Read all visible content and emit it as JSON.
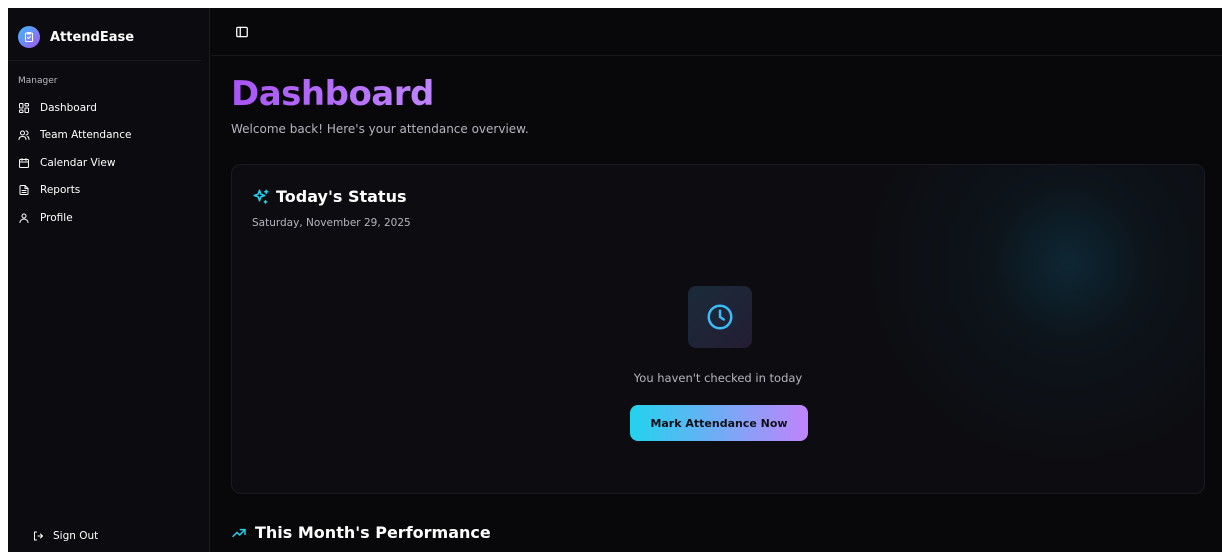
{
  "app": {
    "name": "AttendEase"
  },
  "sidebar": {
    "section_label": "Manager",
    "items": [
      {
        "label": "Dashboard",
        "icon": "dashboard-icon"
      },
      {
        "label": "Team Attendance",
        "icon": "users-icon"
      },
      {
        "label": "Calendar View",
        "icon": "calendar-icon"
      },
      {
        "label": "Reports",
        "icon": "file-icon"
      },
      {
        "label": "Profile",
        "icon": "user-icon"
      }
    ],
    "sign_out": "Sign Out"
  },
  "page": {
    "title": "Dashboard",
    "subtitle": "Welcome back! Here's your attendance overview."
  },
  "status_card": {
    "title": "Today's Status",
    "date": "Saturday, November 29, 2025",
    "message": "You haven't checked in today",
    "button_label": "Mark Attendance Now"
  },
  "performance": {
    "title": "This Month's Performance"
  },
  "colors": {
    "accent_purple": "#a855f7",
    "accent_cyan": "#22d3ee",
    "background": "#08080b"
  }
}
